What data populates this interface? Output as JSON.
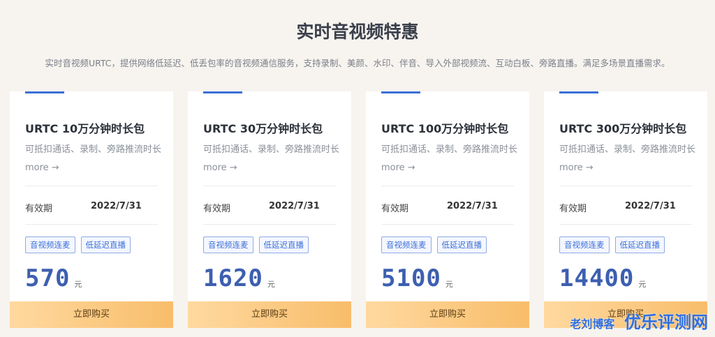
{
  "section": {
    "title": "实时音视频特惠",
    "description": "实时音视频URTC，提供网络低延迟、低丢包率的音视频通信服务，支持录制、美颜、水印、伴音、导入外部视频流、互动白板、旁路直播。满足多场景直播需求。"
  },
  "colors": {
    "accent": "#3b6fd8",
    "price": "#3d5fb0",
    "button_start": "#ffd9a0",
    "button_end": "#f8bd6a"
  },
  "cards": [
    {
      "title": "URTC 10万分钟时长包",
      "desc": "可抵扣通话、录制、旁路推流时长",
      "more": "more →",
      "validity_label": "有效期",
      "validity_value": "2022/7/31",
      "tags": [
        "音视频连麦",
        "低延迟直播"
      ],
      "price": "570",
      "unit": "元",
      "button": "立即购买"
    },
    {
      "title": "URTC 30万分钟时长包",
      "desc": "可抵扣通话、录制、旁路推流时长",
      "more": "more →",
      "validity_label": "有效期",
      "validity_value": "2022/7/31",
      "tags": [
        "音视频连麦",
        "低延迟直播"
      ],
      "price": "1620",
      "unit": "元",
      "button": "立即购买"
    },
    {
      "title": "URTC 100万分钟时长包",
      "desc": "可抵扣通话、录制、旁路推流时长",
      "more": "more →",
      "validity_label": "有效期",
      "validity_value": "2022/7/31",
      "tags": [
        "音视频连麦",
        "低延迟直播"
      ],
      "price": "5100",
      "unit": "元",
      "button": "立即购买"
    },
    {
      "title": "URTC 300万分钟时长包",
      "desc": "可抵扣通话、录制、旁路推流时长",
      "more": "more →",
      "validity_label": "有效期",
      "validity_value": "2022/7/31",
      "tags": [
        "音视频连麦",
        "低延迟直播"
      ],
      "price": "14400",
      "unit": "元",
      "button": "立即购买"
    }
  ],
  "watermark": {
    "text1": "老刘博客",
    "text2": "优乐评测网"
  }
}
